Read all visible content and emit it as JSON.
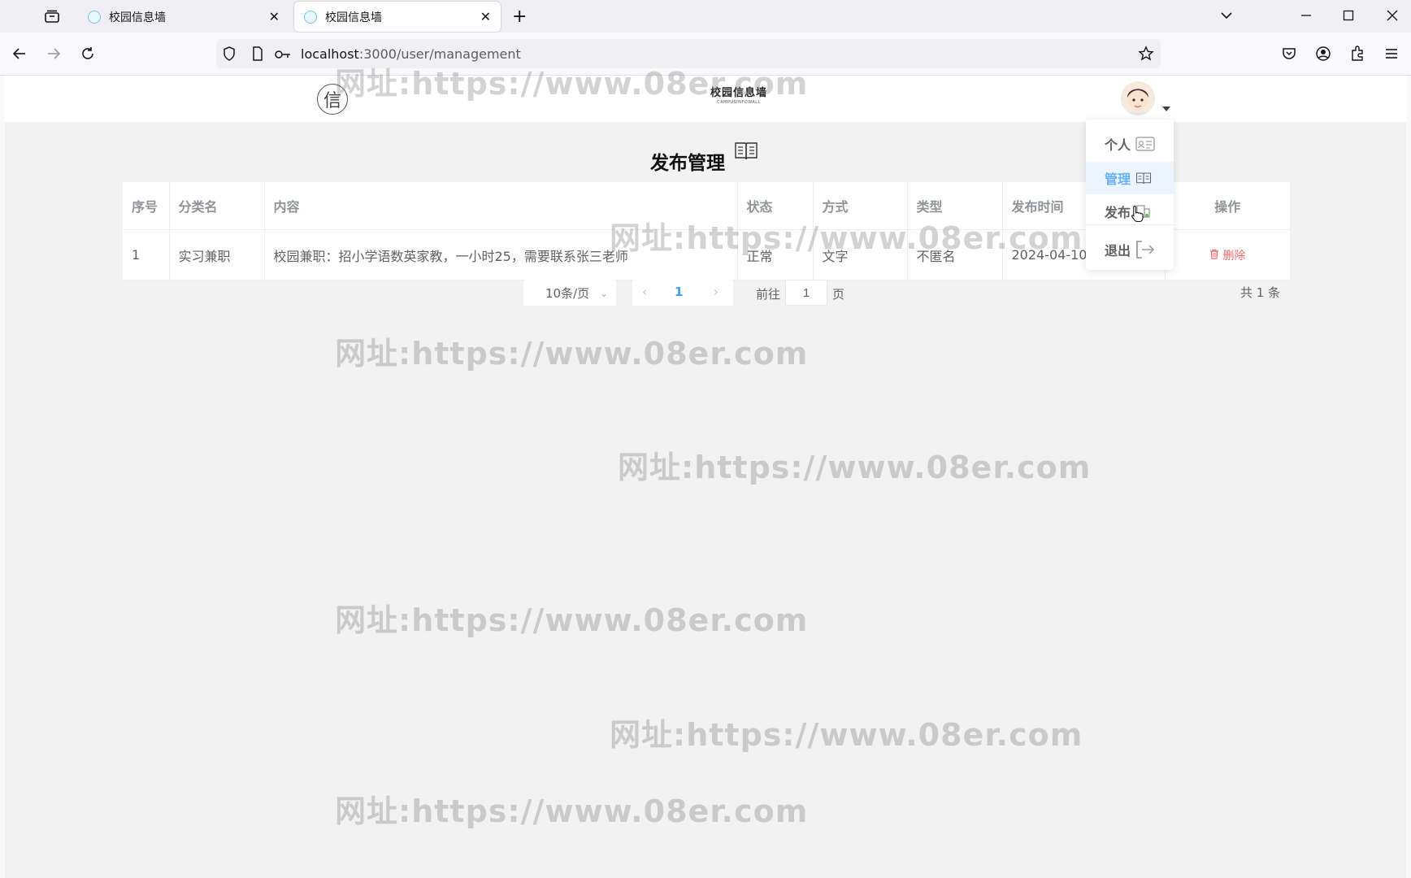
{
  "browser": {
    "tabs": [
      {
        "label": "校园信息墙",
        "active": false
      },
      {
        "label": "校园信息墙",
        "active": true
      }
    ],
    "url_host": "localhost",
    "url_path": ":3000/user/management"
  },
  "header": {
    "logo_char": "信",
    "brand_cn": "校园信息墙",
    "brand_en": "CAMPUSINFOWALL"
  },
  "section": {
    "title": "发布管理"
  },
  "table": {
    "columns": [
      "序号",
      "分类名",
      "内容",
      "状态",
      "方式",
      "类型",
      "发布时间",
      "操作"
    ],
    "rows": [
      {
        "index": "1",
        "category": "实习兼职",
        "content": "校园兼职：招小学语数英家教，一小时25，需要联系张三老师",
        "status": "正常",
        "method": "文字",
        "type": "不匿名",
        "time": "2024-04-10",
        "action": "删除"
      }
    ]
  },
  "pagination": {
    "page_size": "10条/页",
    "current_page": "1",
    "goto_label": "前往",
    "goto_value": "1",
    "goto_suffix": "页",
    "total": "共 1 条"
  },
  "dropdown": {
    "items": [
      {
        "label": "个人",
        "icon": "profile-card-icon"
      },
      {
        "label": "管理",
        "icon": "book-icon",
        "active": true
      },
      {
        "label": "发布",
        "icon": "publish-icon"
      },
      {
        "label": "退出",
        "icon": "logout-icon"
      }
    ]
  },
  "watermark": "网址:https://www.08er.com",
  "colors": {
    "accent": "#409eff",
    "danger": "#f56c6c",
    "active_bg": "#ecf5ff"
  }
}
